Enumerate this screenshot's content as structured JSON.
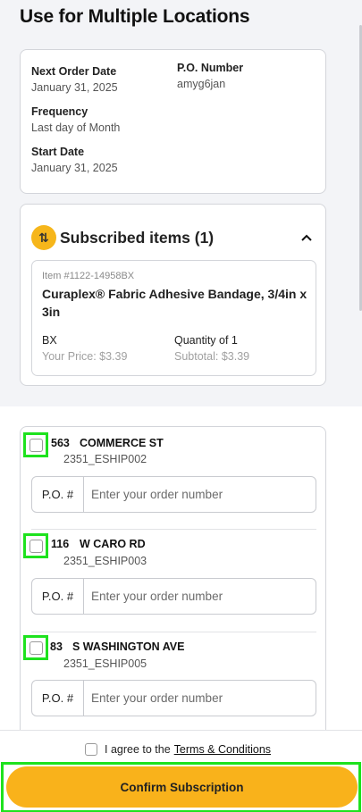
{
  "page": {
    "title": "Use for Multiple Locations"
  },
  "summary": {
    "next_order_label": "Next Order Date",
    "next_order_value": "January 31, 2025",
    "po_label": "P.O. Number",
    "po_value": "amyg6jan",
    "frequency_label": "Frequency",
    "frequency_value": "Last day of Month",
    "start_label": "Start Date",
    "start_value": "January 31, 2025"
  },
  "subscribed": {
    "icon": "subscription-icon",
    "icon_glyph": "⇅",
    "title": "Subscribed items (1)",
    "item": {
      "number": "Item #1122-14958BX",
      "name": "Curaplex® Fabric Adhesive Bandage, 3/4in x 3in",
      "uom": "BX",
      "price": "Your Price: $3.39",
      "quantity": "Quantity of 1",
      "subtotal": "Subtotal: $3.39"
    }
  },
  "locations": [
    {
      "number": "563",
      "street": "COMMERCE ST",
      "code": "2351_ESHIP002",
      "po_label": "P.O. #",
      "po_placeholder": "Enter your order number"
    },
    {
      "number": "116",
      "street": "W CARO RD",
      "code": "2351_ESHIP003",
      "po_label": "P.O. #",
      "po_placeholder": "Enter your order number"
    },
    {
      "number": "83",
      "street": "S WASHINGTON AVE",
      "code": "2351_ESHIP005",
      "po_label": "P.O. #",
      "po_placeholder": "Enter your order number"
    }
  ],
  "footer": {
    "agree_text": "I agree to the",
    "terms_link": "Terms & Conditions",
    "confirm_label": "Confirm Subscription"
  },
  "colors": {
    "accent": "#f9b21b",
    "highlight": "#1ee21e"
  }
}
